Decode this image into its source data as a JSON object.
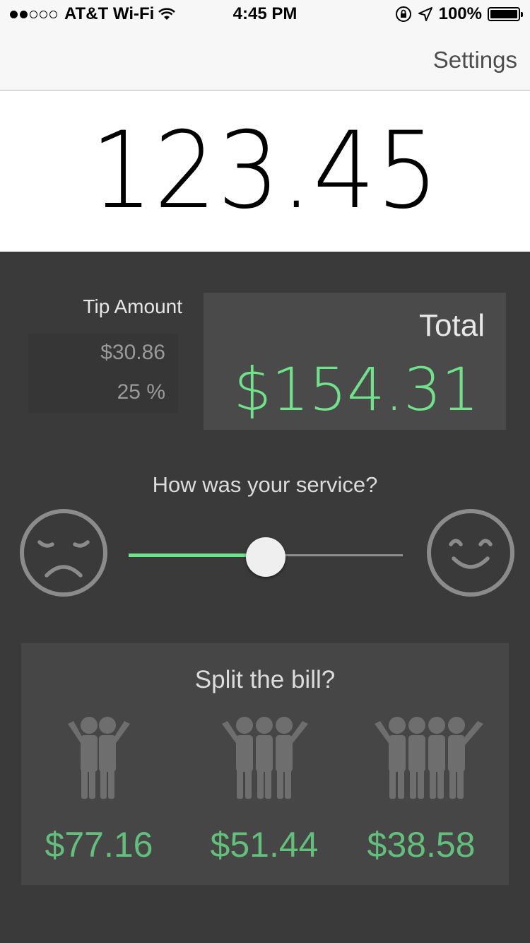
{
  "status_bar": {
    "carrier": "AT&T Wi-Fi",
    "time": "4:45 PM",
    "battery": "100%",
    "signal_bars_filled": 2,
    "signal_bars_total": 5
  },
  "nav": {
    "settings_label": "Settings"
  },
  "bill": {
    "amount": "123.45"
  },
  "tip": {
    "label": "Tip Amount",
    "amount": "$30.86",
    "percent": "25 %"
  },
  "total": {
    "label": "Total",
    "amount": "$154.31"
  },
  "service": {
    "question": "How was your service?",
    "slider_level": 0.5,
    "left_icon": "sad-face-icon",
    "right_icon": "happy-face-icon"
  },
  "split": {
    "title": "Split the bill?",
    "options": [
      {
        "people": 2,
        "amount": "$77.16",
        "icon": "two-people-icon"
      },
      {
        "people": 3,
        "amount": "$51.44",
        "icon": "three-people-icon"
      },
      {
        "people": 4,
        "amount": "$38.58",
        "icon": "four-people-icon"
      }
    ]
  },
  "colors": {
    "accent_green": "#6fe28a",
    "split_green": "#62bf7c",
    "background": "#3a3a3a",
    "icon_gray": "#6e6e6e"
  }
}
